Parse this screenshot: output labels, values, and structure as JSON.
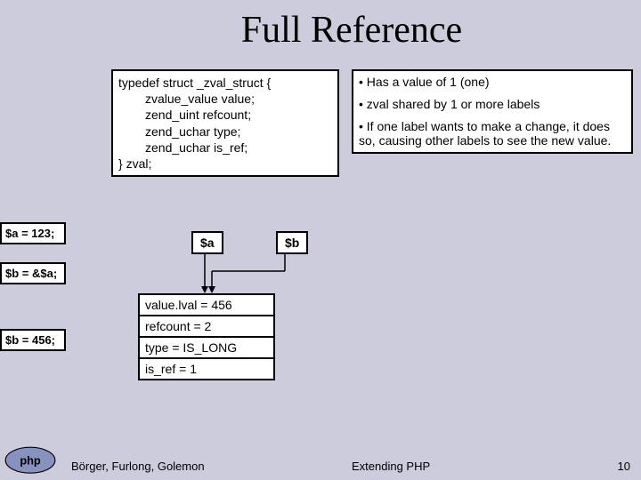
{
  "title": "Full Reference",
  "left": {
    "a": "$a = 123;",
    "b": "$b = &$a;",
    "c": "$b = 456;"
  },
  "code": {
    "l1": "typedef struct _zval_struct {",
    "l2": "zvalue_value value;",
    "l3": "zend_uint refcount;",
    "l4": "zend_uchar type;",
    "l5": "zend_uchar is_ref;",
    "l6": "} zval;"
  },
  "notes": {
    "n1": "• Has a value of 1 (one)",
    "n2": "• zval shared by 1 or more labels",
    "n3": "• If one label wants to make a change, it does so, causing other labels to see the new value."
  },
  "vars": {
    "a": "$a",
    "b": "$b"
  },
  "struct": {
    "s1": "value.lval = 456",
    "s2": "refcount = 2",
    "s3": "type = IS_LONG",
    "s4": "is_ref = 1"
  },
  "footer": {
    "left": "Börger, Furlong, Golemon",
    "center": "Extending PHP",
    "right": "10"
  }
}
